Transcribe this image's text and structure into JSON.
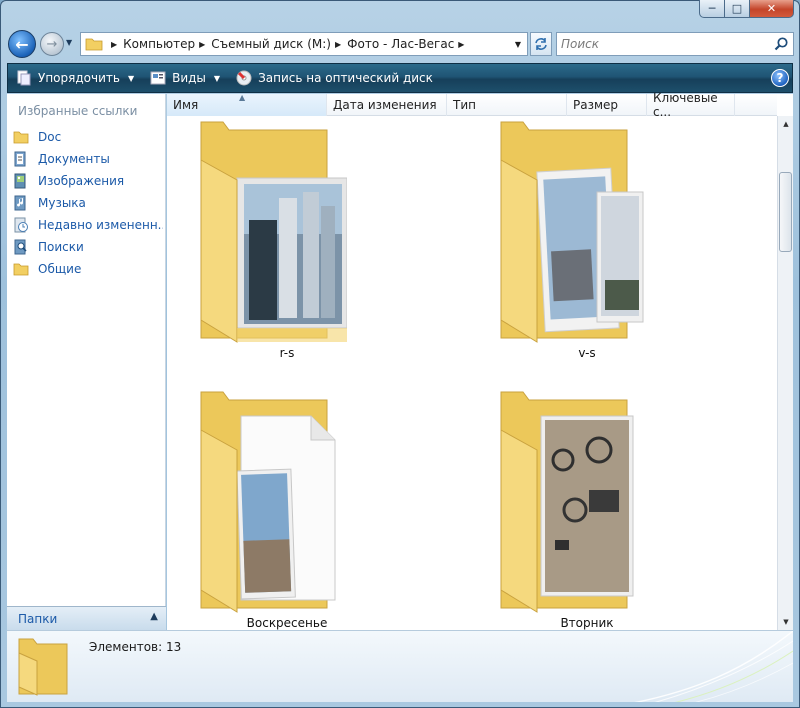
{
  "window": {
    "min_glyph": "─",
    "max_glyph": "□",
    "close_glyph": "✕"
  },
  "nav": {
    "back_glyph": "←",
    "forward_glyph": "→",
    "breadcrumbs": [
      "Компьютер",
      "Съемный диск (M:)",
      "Фото - Лас-Вегас"
    ],
    "search_placeholder": "Поиск"
  },
  "toolbar": {
    "organize": "Упорядочить",
    "views": "Виды",
    "burn": "Запись на оптический диск",
    "help": "?"
  },
  "sidebar": {
    "heading": "Избранные ссылки",
    "items": [
      {
        "label": "Doc",
        "icon": "folder-icon"
      },
      {
        "label": "Документы",
        "icon": "documents-icon"
      },
      {
        "label": "Изображения",
        "icon": "pictures-icon"
      },
      {
        "label": "Музыка",
        "icon": "music-icon"
      },
      {
        "label": "Недавно измененн...",
        "icon": "recent-icon"
      },
      {
        "label": "Поиски",
        "icon": "searches-icon"
      },
      {
        "label": "Общие",
        "icon": "public-folder-icon"
      }
    ],
    "folders_label": "Папки"
  },
  "columns": [
    "Имя",
    "Дата изменения",
    "Тип",
    "Размер",
    "Ключевые с..."
  ],
  "items": [
    {
      "name": "r-s",
      "thumb": "photos"
    },
    {
      "name": "v-s",
      "thumb": "photos"
    },
    {
      "name": "Воскресенье",
      "thumb": "photo-doc"
    },
    {
      "name": "Вторник",
      "thumb": "robot-photos"
    }
  ],
  "details": {
    "count_text": "Элементов: 13"
  },
  "colors": {
    "link": "#1c5aa8",
    "toolbar": "#1f5474",
    "folder_yellow": "#f4d77a"
  }
}
